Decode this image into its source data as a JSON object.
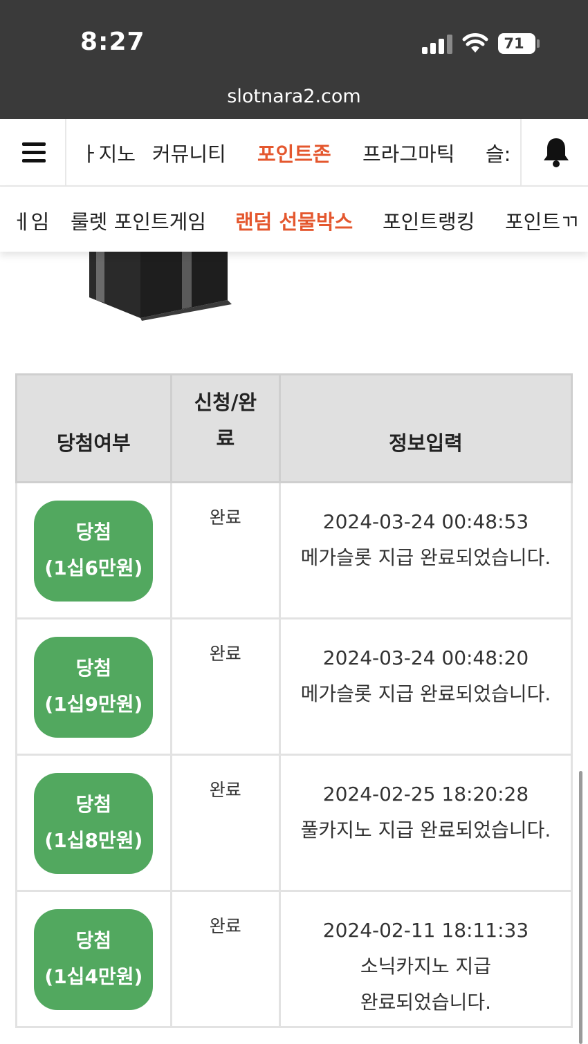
{
  "status_bar": {
    "time": "8:27",
    "battery": "71"
  },
  "browser": {
    "url": "slotnara2.com"
  },
  "main_nav": {
    "items": [
      "ㅏ지노",
      "커뮤니티",
      "포인트존",
      "프라그마틱",
      "슬:"
    ],
    "active_index": 2,
    "accent_color": "#e4572e"
  },
  "sub_nav": {
    "items": [
      "ㅔ임",
      "룰렛 포인트게임",
      "랜덤 선물박스",
      "포인트랭킹",
      "포인트ㄲ"
    ],
    "active_index": 2
  },
  "table": {
    "headers": [
      "당첨여부",
      "신청/완\n료",
      "정보입력"
    ],
    "rows": [
      {
        "badge_line1": "당첨",
        "badge_line2": "(1십6만원)",
        "status": "완료",
        "date": "2024-03-24 00:48:53",
        "message": "메가슬롯 지급 완료되었습니다."
      },
      {
        "badge_line1": "당첨",
        "badge_line2": "(1십9만원)",
        "status": "완료",
        "date": "2024-03-24 00:48:20",
        "message": "메가슬롯 지급 완료되었습니다."
      },
      {
        "badge_line1": "당첨",
        "badge_line2": "(1십8만원)",
        "status": "완료",
        "date": "2024-02-25 18:20:28",
        "message": "풀카지노 지급 완료되었습니다."
      },
      {
        "badge_line1": "당첨",
        "badge_line2": "(1십4만원)",
        "status": "완료",
        "date": "2024-02-11 18:11:33",
        "message_line1": "소닉카지노 지급",
        "message_line2": "완료되었습니다."
      }
    ],
    "badge_color": "#52a85f"
  }
}
